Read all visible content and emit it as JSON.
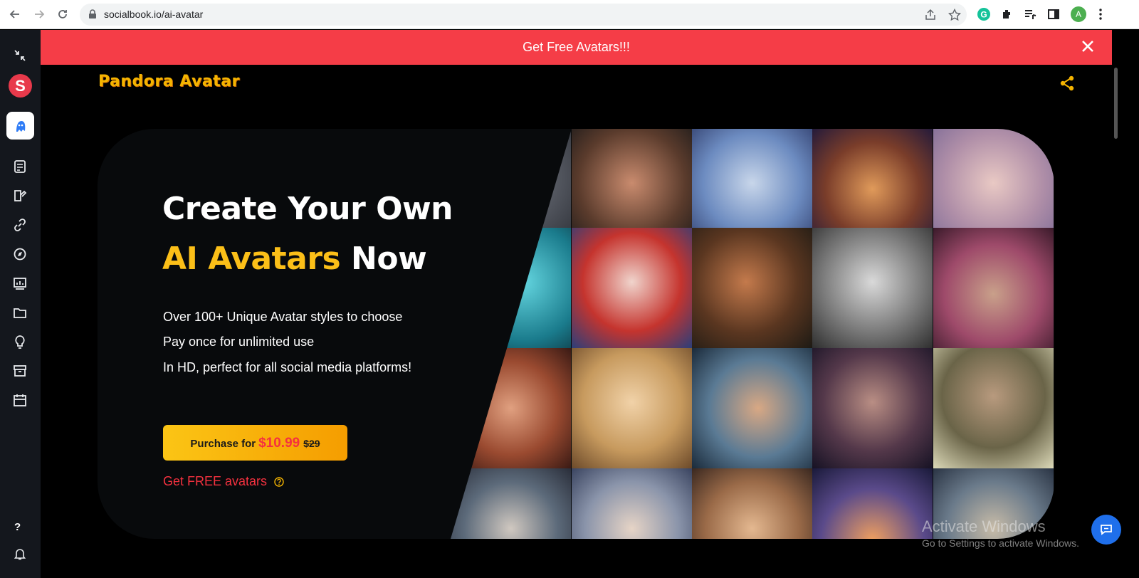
{
  "browser": {
    "url": "socialbook.io/ai-avatar",
    "profile_initial": "A"
  },
  "sidebar": {
    "logo_letter": "S",
    "items": [
      "collapse-icon",
      "socialbook-logo",
      "avatar-tool-icon",
      "document-icon",
      "editor-icon",
      "link-icon",
      "explore-icon",
      "analytics-icon",
      "folder-icon",
      "idea-icon",
      "archive-icon",
      "calendar-icon"
    ],
    "help_label": "?"
  },
  "banner": {
    "text": "Get Free Avatars!!!"
  },
  "header": {
    "brand": "Pandora Avatar"
  },
  "hero": {
    "title_line1": "Create Your Own",
    "title_accent": "AI Avatars",
    "title_rest": " Now",
    "features": [
      "Over 100+ Unique Avatar styles to choose",
      "Pay once for unlimited use",
      "In HD, perfect for all social media platforms!"
    ],
    "purchase_label": "Purchase for",
    "price": "$10.99",
    "old_price": "$29",
    "free_link": "Get FREE avatars"
  },
  "watermark": {
    "line1": "Activate Windows",
    "line2": "Go to Settings to activate Windows."
  },
  "colors": {
    "accent": "#fbbf18",
    "banner": "#f53d47",
    "price": "#f5313f"
  }
}
